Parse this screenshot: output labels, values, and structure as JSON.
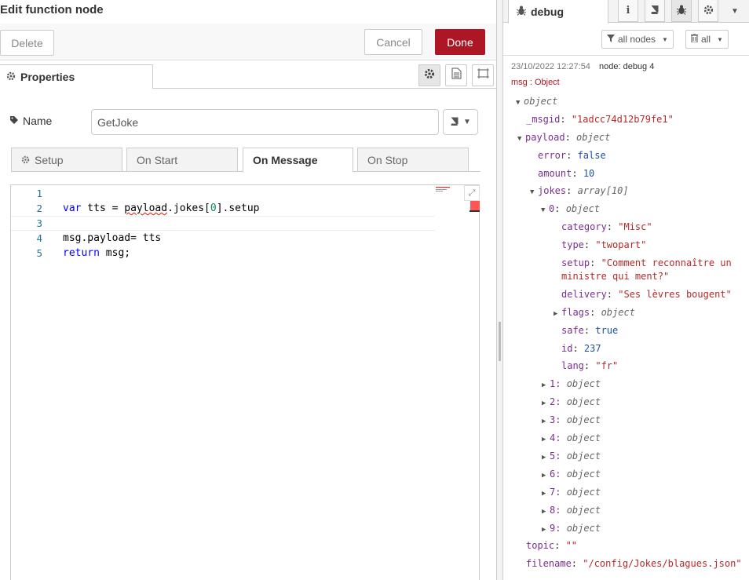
{
  "window": {
    "title": "Edit function node"
  },
  "actions": {
    "delete": "Delete",
    "cancel": "Cancel",
    "done": "Done"
  },
  "tabs": {
    "properties": "Properties"
  },
  "name_field": {
    "label": "Name",
    "value": "GetJoke"
  },
  "subtabs": [
    "Setup",
    "On Start",
    "On Message",
    "On Stop"
  ],
  "editor": {
    "line_numbers": [
      "1",
      "2",
      "3",
      "4",
      "5"
    ],
    "lines": [
      "",
      "var tts = payload.jokes[0].setup",
      "",
      "msg.payload= tts",
      "return msg;"
    ]
  },
  "sidebar": {
    "tab": "debug",
    "filter_nodes": "all nodes",
    "filter_clear": "all",
    "message": {
      "timestamp": "23/10/2022 12:27:54",
      "node": "node: debug 4",
      "type": "msg : Object",
      "tree": {
        "root": "object",
        "msgid_key": "_msgid",
        "msgid_val": "\"1adcc74d12b79fe1\"",
        "payload_key": "payload",
        "payload_type": "object",
        "error_key": "error",
        "error_val": "false",
        "amount_key": "amount",
        "amount_val": "10",
        "jokes_key": "jokes",
        "jokes_type": "array[10]",
        "item0_key": "0",
        "item0_type": "object",
        "category_key": "category",
        "category_val": "\"Misc\"",
        "type_key": "type",
        "type_val": "\"twopart\"",
        "setup_key": "setup",
        "setup_val_1": "\"Comment reconnaître un",
        "setup_val_2": "ministre qui ment?\"",
        "delivery_key": "delivery",
        "delivery_val": "\"Ses lèvres bougent\"",
        "flags_key": "flags",
        "flags_type": "object",
        "safe_key": "safe",
        "safe_val": "true",
        "id_key": "id",
        "id_val": "237",
        "lang_key": "lang",
        "lang_val": "\"fr\"",
        "items": [
          "1",
          "2",
          "3",
          "4",
          "5",
          "6",
          "7",
          "8",
          "9"
        ],
        "item_type": "object",
        "topic_key": "topic",
        "topic_val": "\"\"",
        "filename_key": "filename",
        "filename_val": "\"/config/Jokes/blagues.json\""
      }
    }
  }
}
